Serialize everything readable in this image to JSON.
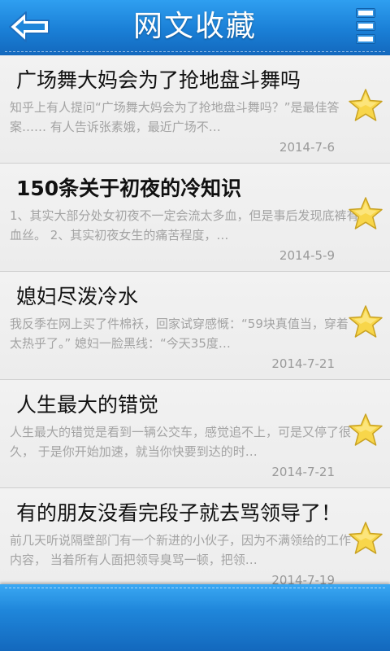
{
  "header": {
    "title": "网文收藏",
    "back_icon": "back-arrow-icon",
    "menu_icon": "menu-icon"
  },
  "colors": {
    "header_blue": "#1a7fd6",
    "star_yellow": "#f8d64a"
  },
  "items": [
    {
      "title": "广场舞大妈会为了抢地盘斗舞吗",
      "snippet": "知乎上有人提问“广场舞大妈会为了抢地盘斗舞吗？”是最佳答案…… 有人告诉张素娥，最近广场不…",
      "date": "2014-7-6",
      "favorited": true
    },
    {
      "title": "150条关于初夜的冷知识",
      "snippet": "1、其实大部分处女初夜不一定会流太多血，但是事后发现底裤有血丝。 2、其实初夜女生的痛苦程度，…",
      "date": "2014-5-9",
      "favorited": true
    },
    {
      "title": "媳妇尽泼冷水",
      "snippet": "我反季在网上买了件棉袄，回家试穿感慨：“59块真值当，穿着太热乎了。” 媳妇一脸黑线：“今天35度…",
      "date": "2014-7-21",
      "favorited": true
    },
    {
      "title": "人生最大的错觉",
      "snippet": "人生最大的错觉是看到一辆公交车，感觉追不上，可是又停了很久， 于是你开始加速，就当你快要到达的时…",
      "date": "2014-7-21",
      "favorited": true
    },
    {
      "title": "有的朋友没看完段子就去骂领导了！",
      "snippet": "前几天听说隔壁部门有一个新进的小伙子，因为不满领给的工作内容， 当着所有人面把领导臭骂一顿，把领…",
      "date": "2014-7-19",
      "favorited": true
    }
  ]
}
